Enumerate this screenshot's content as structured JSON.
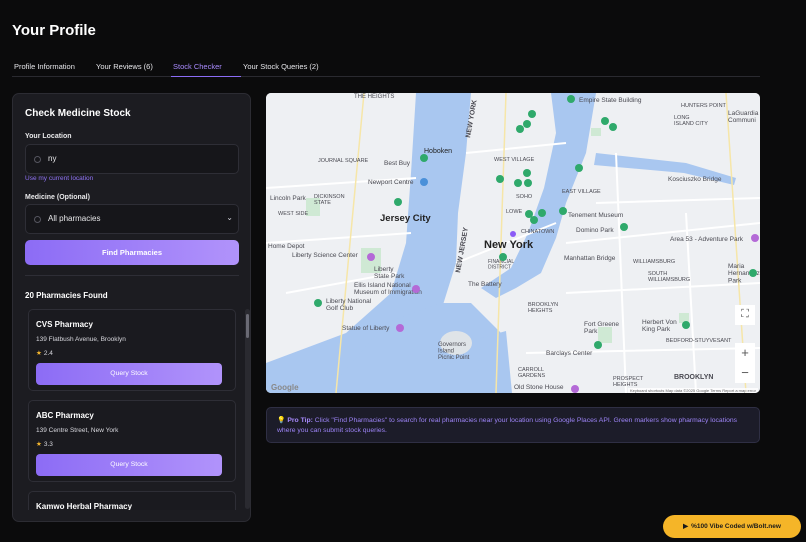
{
  "page": {
    "title": "Your Profile"
  },
  "tabs": [
    {
      "label": "Profile Information",
      "active": false
    },
    {
      "label": "Your Reviews (6)",
      "active": false
    },
    {
      "label": "Stock Checker",
      "active": true
    },
    {
      "label": "Your Stock Queries (2)",
      "active": false
    }
  ],
  "stock_panel": {
    "title": "Check Medicine Stock",
    "location_label": "Your Location",
    "location_value": "ny",
    "use_location_link": "Use my current location",
    "medicine_label": "Medicine (Optional)",
    "medicine_selected": "All pharmacies",
    "find_button": "Find Pharmacies",
    "results_heading": "20 Pharmacies Found",
    "query_button": "Query Stock"
  },
  "pharmacies": [
    {
      "name": "CVS Pharmacy",
      "address": "139 Flatbush Avenue, Brooklyn",
      "rating": "2.4"
    },
    {
      "name": "ABC Pharmacy",
      "address": "139 Centre Street, New York",
      "rating": "3.3"
    },
    {
      "name": "Kamwo Herbal Pharmacy"
    }
  ],
  "map": {
    "labels": {
      "the_heights": "THE HEIGHTS",
      "hoboken": "Hoboken",
      "journal_square": "JOURNAL SQUARE",
      "best_buy": "Best Buy",
      "newport_centre": "Newport Centre",
      "west_village": "WEST VILLAGE",
      "empire_state": "Empire State Building",
      "hunters_point": "HUNTERS POINT",
      "long_island_city": "LONG\nISLAND CITY",
      "laguardia": "LaGuardia\nCommuni",
      "east_village": "EAST VILLAGE",
      "kosciuszko": "Kosciuszko Bridge",
      "lincoln_park": "Lincoln Park",
      "dickinson": "DICKINSON\nSTATE",
      "west_side": "WEST SIDE",
      "jersey_city": "Jersey City",
      "soho": "SOHO",
      "lower": "LOWE",
      "tenement": "Tenement Museum",
      "domino": "Domino Park",
      "chinatown": "CHINATOWN",
      "new_york": "New York",
      "financial_district": "FINANCIAL\nDISTRICT",
      "home_depot": "Home Depot",
      "liberty_science": "Liberty Science Center",
      "manhattan_bridge": "Manhattan Bridge",
      "area53": "Area 53 - Adventure Park",
      "williamsburg": "WILLIAMSBURG",
      "south_williamsburg": "SOUTH\nWILLIAMSBURG",
      "maria_hernandez": "Maria\nHernandez\nPark",
      "liberty_state": "Liberty\nState Park",
      "the_battery": "The Battery",
      "ellis_island": "Ellis Island National\nMuseum of Immigration",
      "liberty_golf": "Liberty National\nGolf Club",
      "brooklyn_heights": "BROOKLYN\nHEIGHTS",
      "fort_greene": "Fort Greene\nPark",
      "herbert_von_king": "Herbert Von\nKing Park",
      "bedford_stuyvesant": "BEDFORD-STUYVESANT",
      "statue_of_liberty": "Statue of Liberty",
      "governors_island": "Governors\nIsland\nPicnic Point",
      "barclays": "Barclays Center",
      "carroll_gardens": "CARROLL\nGARDENS",
      "old_stone_house": "Old Stone House",
      "prospect_heights": "PROSPECT\nHEIGHTS",
      "brooklyn": "BROOKLYN",
      "new_jersey": "NEW JERSEY",
      "new_york_state": "NEW YORK",
      "attribution": "Keyboard shortcuts   Map data ©2025 Google   Terms   Report a map error",
      "google": "Google"
    }
  },
  "tip": {
    "label": "💡 Pro Tip:",
    "text": " Click \"Find Pharmacies\" to search for real pharmacies near your location using Google Places API. Green markers show pharmacy locations where you can submit stock queries."
  },
  "badge": {
    "label": "%100 Vibe Coded w/Bolt.new",
    "icon": "bolt-icon"
  },
  "colors": {
    "accent": "#8b6cf6",
    "pharmacy_marker": "#2fa96b",
    "badge": "#f5b528"
  }
}
